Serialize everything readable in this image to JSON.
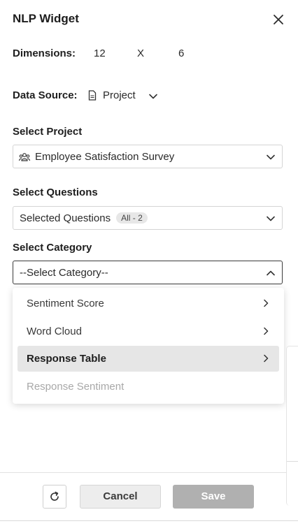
{
  "widget": {
    "title": "NLP Widget"
  },
  "dimensions": {
    "label": "Dimensions:",
    "width": "12",
    "separator": "X",
    "height": "6"
  },
  "data_source": {
    "label": "Data Source:",
    "value": "Project"
  },
  "select_project": {
    "label": "Select Project",
    "value": "Employee Satisfaction Survey"
  },
  "select_questions": {
    "label": "Select Questions",
    "value": "Selected Questions",
    "badge": "All - 2"
  },
  "select_category": {
    "label": "Select Category",
    "placeholder": "--Select Category--",
    "options": [
      {
        "label": "Sentiment Score",
        "state": "normal"
      },
      {
        "label": "Word Cloud",
        "state": "normal"
      },
      {
        "label": "Response Table",
        "state": "active"
      },
      {
        "label": "Response Sentiment",
        "state": "disabled"
      }
    ]
  },
  "footer": {
    "cancel_label": "Cancel",
    "save_label": "Save"
  },
  "icons": {
    "close": "close-icon",
    "document": "document-icon",
    "group": "people-group-icon",
    "chevron_down": "chevron-down-icon",
    "chevron_up": "chevron-up-icon",
    "chevron_right": "chevron-right-icon",
    "refresh": "refresh-icon"
  },
  "colors": {
    "active_item_bg": "#e6e6e6",
    "save_disabled_bg": "#b0b0b0",
    "cancel_bg": "#ededed"
  }
}
